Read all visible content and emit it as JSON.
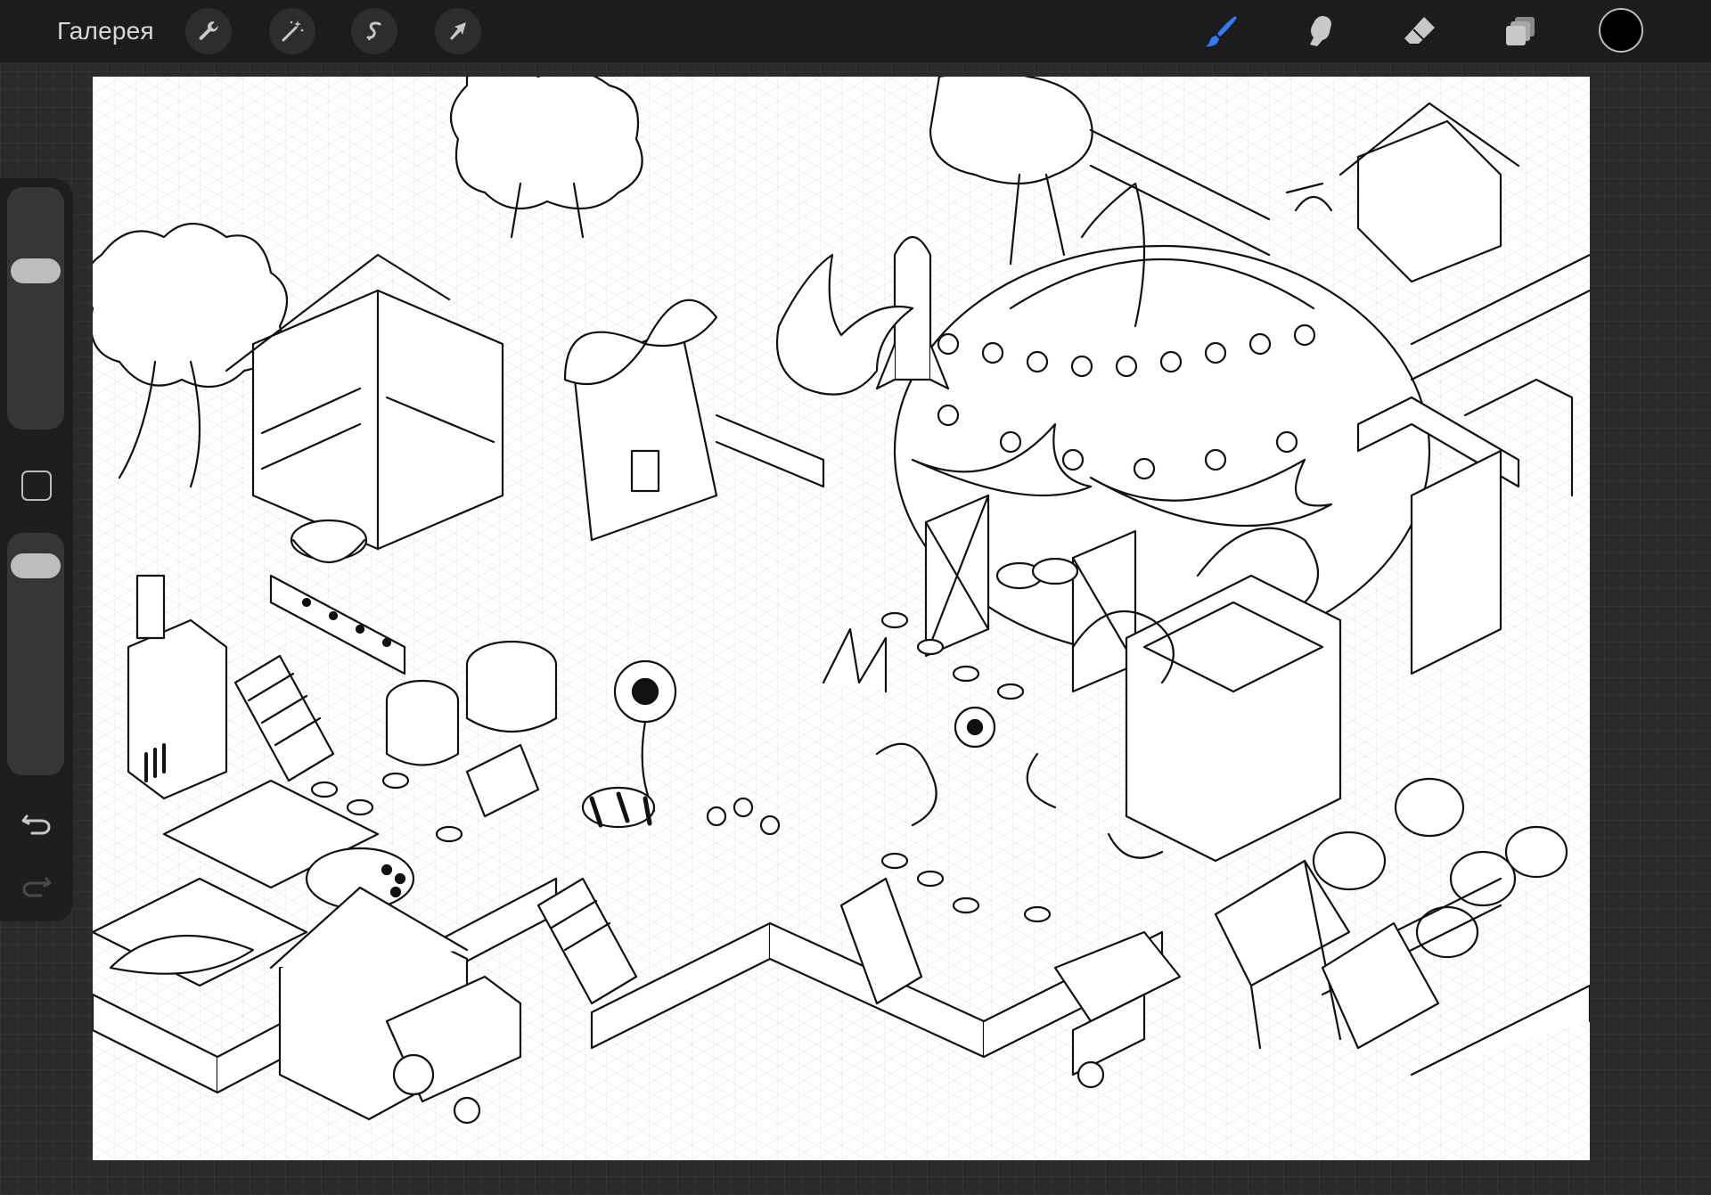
{
  "topbar": {
    "gallery_label": "Галерея",
    "left_tools": [
      {
        "name": "actions",
        "icon": "wrench-icon"
      },
      {
        "name": "adjustments",
        "icon": "magic-wand-icon"
      },
      {
        "name": "selection",
        "icon": "selection-s-icon"
      },
      {
        "name": "transform",
        "icon": "arrow-cursor-icon"
      }
    ],
    "right_tools": [
      {
        "name": "brush",
        "icon": "brush-icon",
        "active": true
      },
      {
        "name": "smudge",
        "icon": "smudge-icon",
        "active": false
      },
      {
        "name": "eraser",
        "icon": "eraser-icon",
        "active": false
      },
      {
        "name": "layers",
        "icon": "layers-icon",
        "active": false
      }
    ],
    "current_color": "#000000"
  },
  "sidebar": {
    "brush_size_level": 0.68,
    "opacity_level": 0.92,
    "modify_icon": "square-icon",
    "undo_icon": "undo-icon",
    "redo_icon": "redo-icon"
  },
  "colors": {
    "accent": "#2f7cf6",
    "toolbar_bg": "#1c1c1c",
    "workspace_bg": "#2a2a2a"
  },
  "canvas": {
    "content": "isometric-halloween-farm-line-art"
  }
}
